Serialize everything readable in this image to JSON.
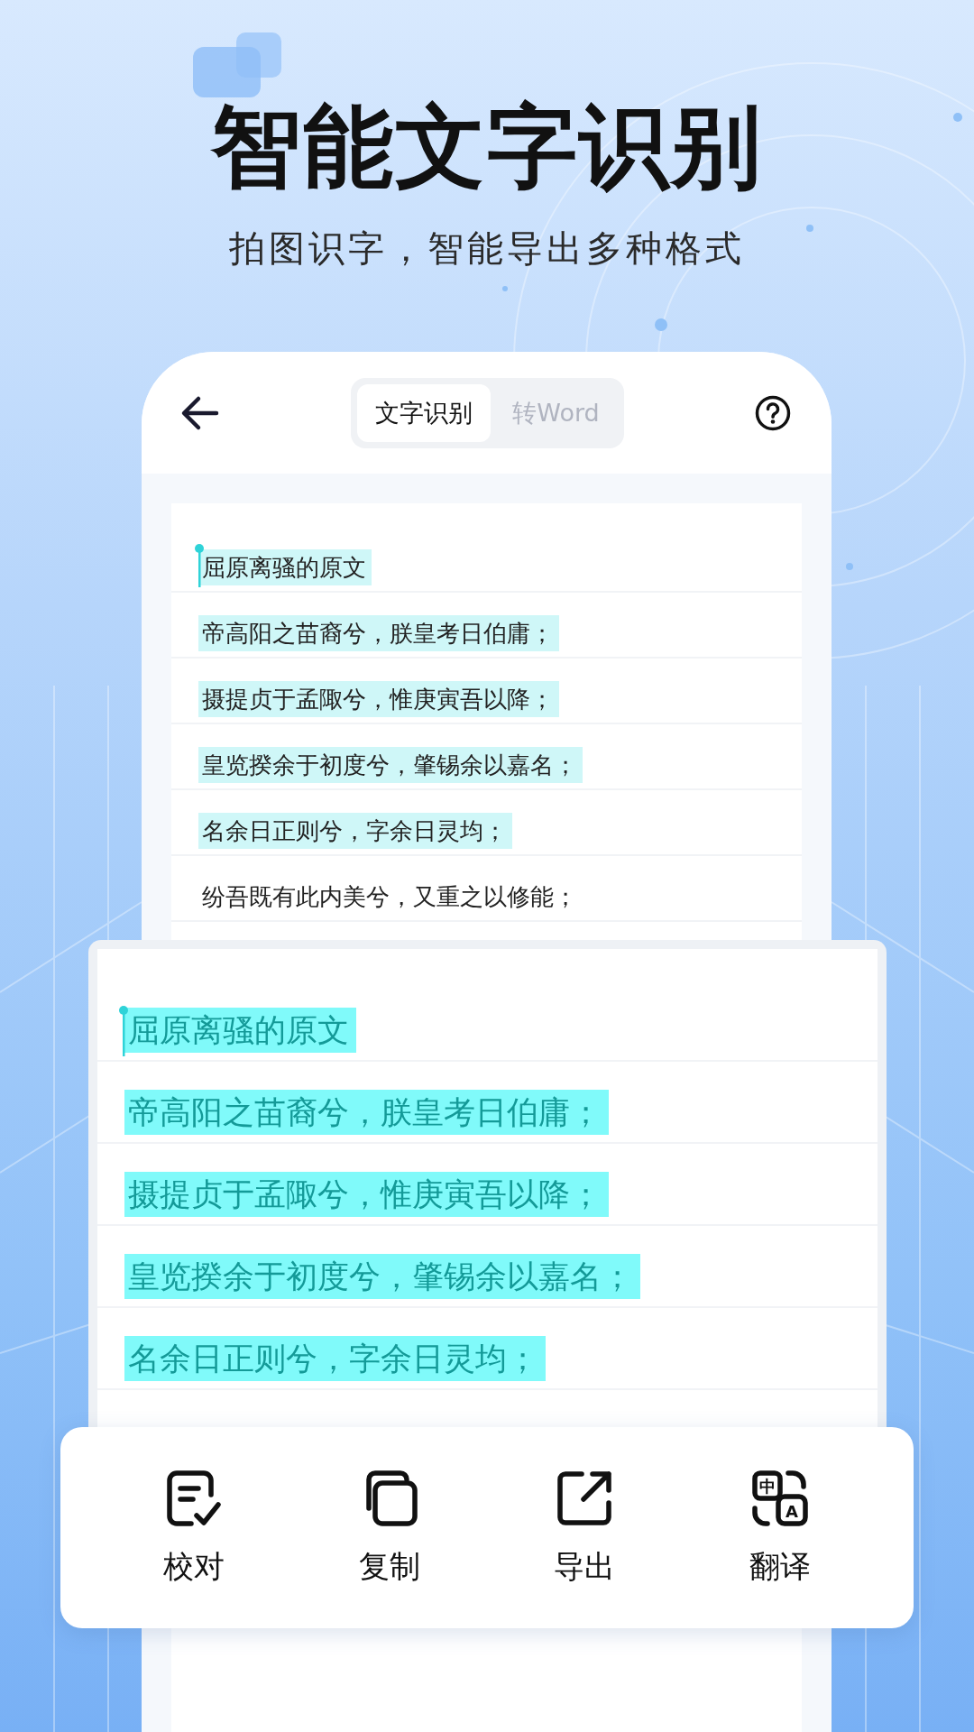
{
  "headline": "智能文字识别",
  "subheadline": "拍图识字，智能导出多种格式",
  "phone": {
    "tabs": [
      {
        "label": "文字识别",
        "selected": true
      },
      {
        "label": "转Word",
        "selected": false
      }
    ],
    "lines": [
      {
        "text": "屈原离骚的原文",
        "highlighted": true,
        "cursor": true
      },
      {
        "text": "帝高阳之苗裔兮，朕皇考日伯庸；",
        "highlighted": true,
        "cursor": false
      },
      {
        "text": "摄提贞于孟陬兮，惟庚寅吾以降；",
        "highlighted": true,
        "cursor": false
      },
      {
        "text": "皇览揆余于初度兮，肇锡余以嘉名；",
        "highlighted": true,
        "cursor": false
      },
      {
        "text": "名余日正则兮，字余日灵均；",
        "highlighted": true,
        "cursor": false
      },
      {
        "text": "纷吾既有此内美兮，又重之以修能；",
        "highlighted": false,
        "cursor": false
      }
    ]
  },
  "magnifier": {
    "lines": [
      {
        "text": "屈原离骚的原文",
        "highlighted": true,
        "cursor": true
      },
      {
        "text": "帝高阳之苗裔兮，朕皇考日伯庸；",
        "highlighted": true,
        "cursor": false
      },
      {
        "text": "摄提贞于孟陬兮，惟庚寅吾以降；",
        "highlighted": true,
        "cursor": false
      },
      {
        "text": "皇览揆余于初度兮，肇锡余以嘉名；",
        "highlighted": true,
        "cursor": false
      },
      {
        "text": "名余日正则兮，字余日灵均；",
        "highlighted": true,
        "cursor": false
      }
    ]
  },
  "actions": [
    {
      "label": "校对",
      "kind": "proofread"
    },
    {
      "label": "复制",
      "kind": "copy"
    },
    {
      "label": "导出",
      "kind": "export"
    },
    {
      "label": "翻译",
      "kind": "translate",
      "glyphs": [
        "中",
        "A"
      ]
    }
  ]
}
